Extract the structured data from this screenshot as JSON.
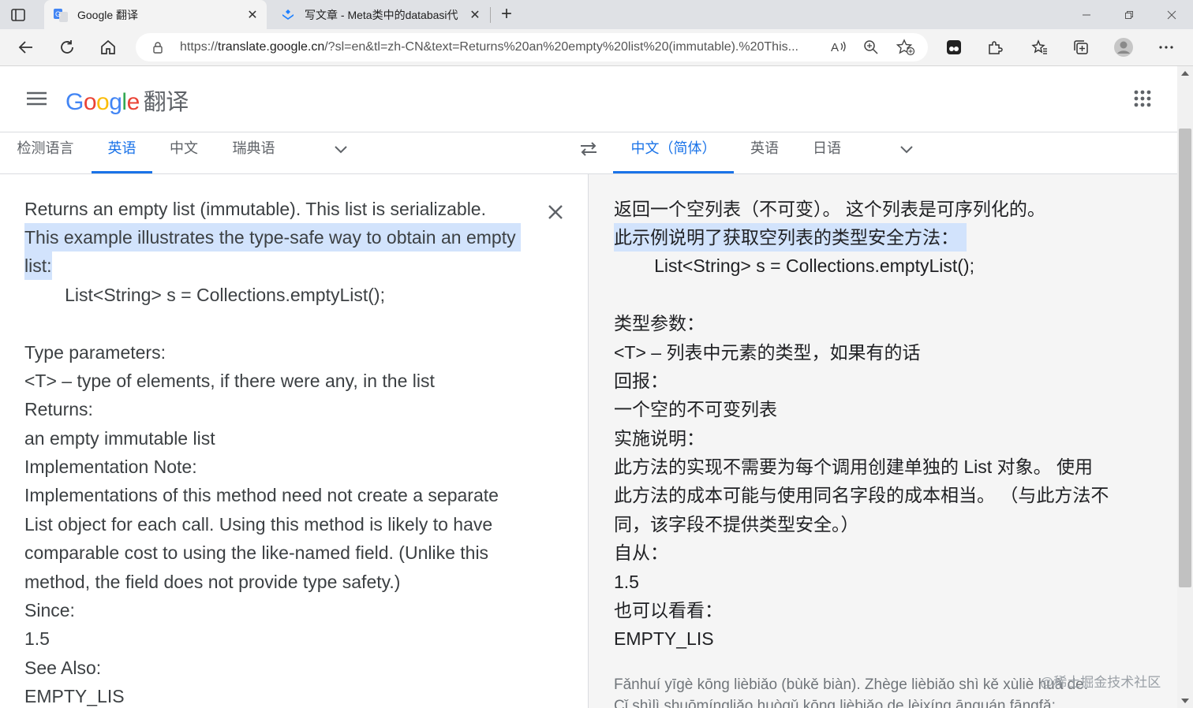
{
  "browser": {
    "tabs": [
      {
        "title": "Google 翻译",
        "active": true
      },
      {
        "title": "写文章 - Meta类中的databasi代",
        "active": false
      }
    ],
    "url_prefix": "https://",
    "url_domain": "translate.google.cn",
    "url_rest": "/?sl=en&tl=zh-CN&text=Returns%20an%20empty%20list%20(immutable).%20This..."
  },
  "header": {
    "logo": [
      "G",
      "o",
      "o",
      "g",
      "l",
      "e"
    ],
    "product": "翻译"
  },
  "source_langs": [
    "检测语言",
    "英语",
    "中文",
    "瑞典语"
  ],
  "source_selected": 1,
  "target_langs": [
    "中文（简体）",
    "英语",
    "日语"
  ],
  "target_selected": 0,
  "source_lines": [
    "Returns an empty list (immutable). This list is serializable.",
    "This example illustrates the type-safe way to obtain an empty",
    "list:",
    "        List<String> s = Collections.emptyList();",
    "",
    "Type parameters:",
    "<T> – type of elements, if there were any, in the list",
    "Returns:",
    "an empty immutable list",
    "Implementation Note:",
    "Implementations of this method need not create a separate",
    "List object for each call. Using this method is likely to have",
    "comparable cost to using the like-named field. (Unlike this",
    "method, the field does not provide type safety.)",
    "Since:",
    "1.5",
    "See Also:",
    "EMPTY_LIS"
  ],
  "target_lines": [
    "返回一个空列表（不可变）。 这个列表是可序列化的。",
    "此示例说明了获取空列表的类型安全方法：",
    "        List<String> s = Collections.emptyList();",
    "",
    "类型参数：",
    "<T> – 列表中元素的类型，如果有的话",
    "回报：",
    "一个空的不可变列表",
    "实施说明：",
    "此方法的实现不需要为每个调用创建单独的 List 对象。 使用",
    "此方法的成本可能与使用同名字段的成本相当。 （与此方法不",
    "同，该字段不提供类型安全。）",
    "自从：",
    "1.5",
    "也可以看看：",
    "EMPTY_LIS"
  ],
  "transliteration": [
    "Fǎnhuí yīgè kōng lièbiǎo (bùkě biàn). Zhège lièbiǎo shì kě xùliè huà de.",
    "Cǐ shìlì shuōmíngliǎo huòqǔ kōng lièbiǎo de lèixíng ānquán fāngfǎ:"
  ],
  "watermark": "@稀土掘金技术社区"
}
